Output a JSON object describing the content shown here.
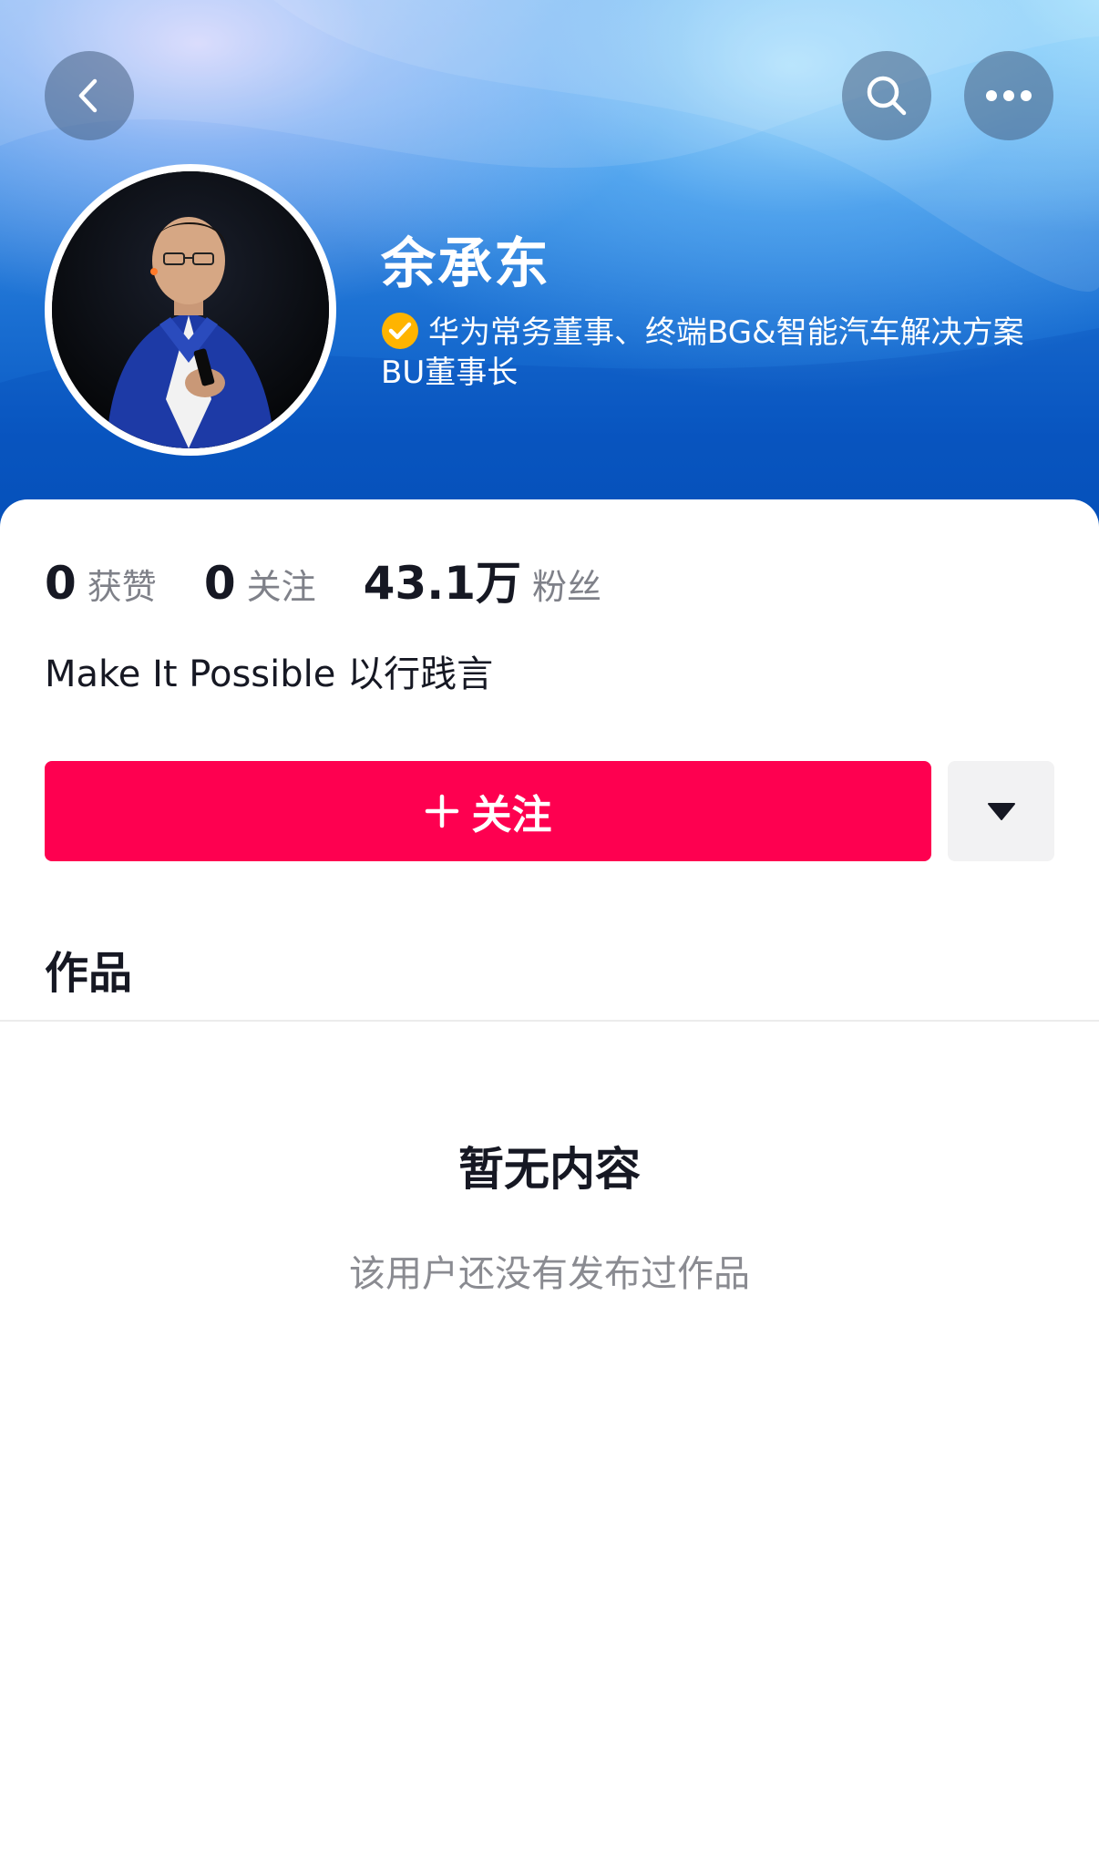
{
  "profile": {
    "name": "余承东",
    "verification": "华为常务董事、终端BG&智能汽车解决方案BU董事长",
    "bio": "Make It Possible 以行践言"
  },
  "stats": [
    {
      "value": "0",
      "label": "获赞"
    },
    {
      "value": "0",
      "label": "关注"
    },
    {
      "value": "43.1万",
      "label": "粉丝"
    }
  ],
  "actions": {
    "follow_label": "关注"
  },
  "tabs": {
    "works_label": "作品"
  },
  "empty_state": {
    "title": "暂无内容",
    "description": "该用户还没有发布过作品"
  },
  "icons": {
    "back": "back-arrow-icon",
    "search": "search-icon",
    "more": "more-dots-icon",
    "verified": "verified-badge-icon",
    "plus": "plus-icon",
    "dropdown": "caret-down-icon"
  },
  "colors": {
    "follow_button": "#fe0050",
    "verified_badge": "#ffb400",
    "header_blue": "#1a6fd2"
  }
}
